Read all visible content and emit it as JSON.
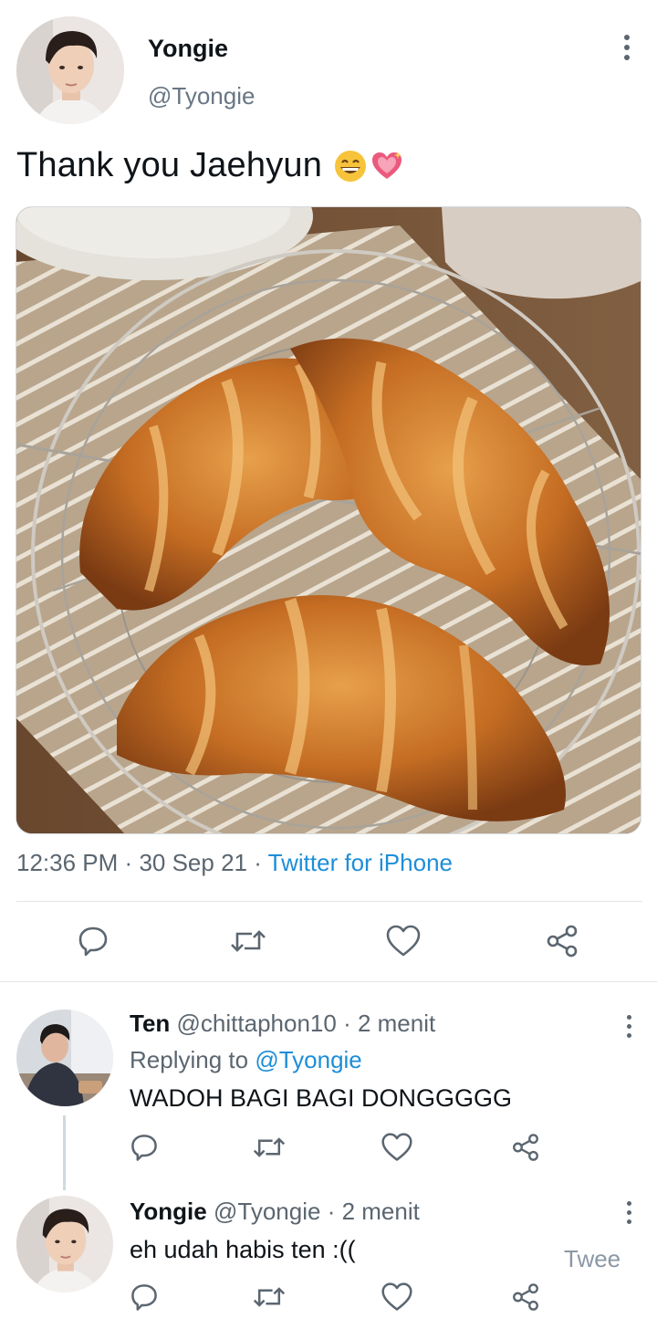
{
  "tweet": {
    "author_name": "Yongie",
    "author_handle": "@Tyongie",
    "text": "Thank you Jaehyun",
    "emojis": [
      "grinning-face-icon",
      "sparkling-heart-icon"
    ],
    "time": "12:36 PM",
    "date": "30 Sep 21",
    "separator": "·",
    "source": "Twitter for iPhone",
    "actions": [
      "reply-icon",
      "retweet-icon",
      "like-icon",
      "share-icon"
    ]
  },
  "replies": [
    {
      "name": "Ten",
      "handle": "@chittaphon10",
      "separator": "·",
      "time": "2 menit",
      "replying_label": "Replying to",
      "replying_to": "@Tyongie",
      "text": "WADOH BAGI BAGI DONGGGGG"
    },
    {
      "name": "Yongie",
      "handle": "@Tyongie",
      "separator": "·",
      "time": "2 menit",
      "text": "eh udah habis ten :((",
      "truncated_label": "Twee"
    }
  ],
  "colors": {
    "link": "#1d8ed8",
    "secondary_text": "#5b6670",
    "icon": "#5b6670",
    "divider": "#e1e6ea"
  }
}
